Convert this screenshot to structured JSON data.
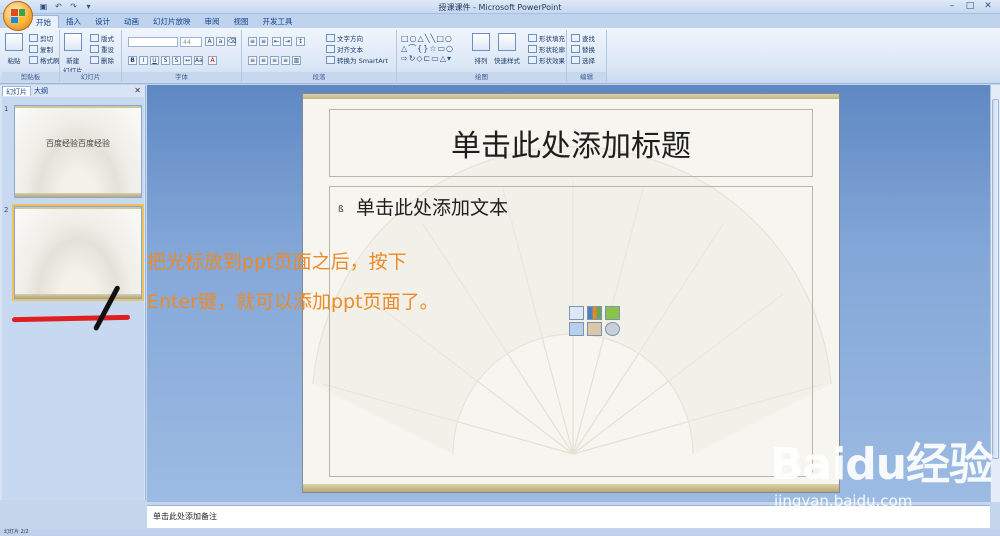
{
  "window": {
    "title": "授课课件 - Microsoft PowerPoint"
  },
  "qat": [
    "save-icon",
    "undo-icon",
    "redo-icon",
    "more-icon"
  ],
  "tabs": [
    {
      "label": "开始",
      "active": true
    },
    {
      "label": "插入",
      "active": false
    },
    {
      "label": "设计",
      "active": false
    },
    {
      "label": "动画",
      "active": false
    },
    {
      "label": "幻灯片放映",
      "active": false
    },
    {
      "label": "审阅",
      "active": false
    },
    {
      "label": "视图",
      "active": false
    },
    {
      "label": "开发工具",
      "active": false
    }
  ],
  "ribbon": {
    "clipboard": {
      "label": "剪贴板",
      "paste": "粘贴",
      "cut": "剪切",
      "copy": "复制",
      "format_painter": "格式刷"
    },
    "slides": {
      "label": "幻灯片",
      "new_slide": "新建\n幻灯片",
      "layout": "版式",
      "reset": "重设",
      "delete": "删除"
    },
    "font": {
      "label": "字体",
      "size": "44"
    },
    "paragraph": {
      "label": "段落",
      "text_direction": "文字方向",
      "align_text": "对齐文本",
      "smartart": "转换为 SmartArt"
    },
    "drawing": {
      "label": "绘图",
      "arrange": "排列",
      "quick_styles": "快速样式",
      "shape_fill": "形状填充",
      "shape_outline": "形状轮廓",
      "shape_effects": "形状效果"
    },
    "editing": {
      "label": "编辑",
      "find": "查找",
      "replace": "替换",
      "select": "选择"
    }
  },
  "left_panel": {
    "tab_slides": "幻灯片",
    "tab_outline": "大纲",
    "slides": [
      {
        "number": "1",
        "text": "百度经验百度经验"
      },
      {
        "number": "2",
        "text": ""
      }
    ]
  },
  "slide": {
    "title_placeholder": "单击此处添加标题",
    "body_placeholder": "单击此处添加文本",
    "bullet": "ß"
  },
  "annotation": {
    "line1": "把光标放到ppt页面之后，按下",
    "line2": "Enter键，就可以添加ppt页面了。"
  },
  "notes": {
    "placeholder": "单击此处添加备注"
  },
  "statusbar": {
    "text": "幻灯片 2/2"
  },
  "watermark": {
    "brand": "Baidu经验",
    "site": "jingyan.baidu.com"
  }
}
